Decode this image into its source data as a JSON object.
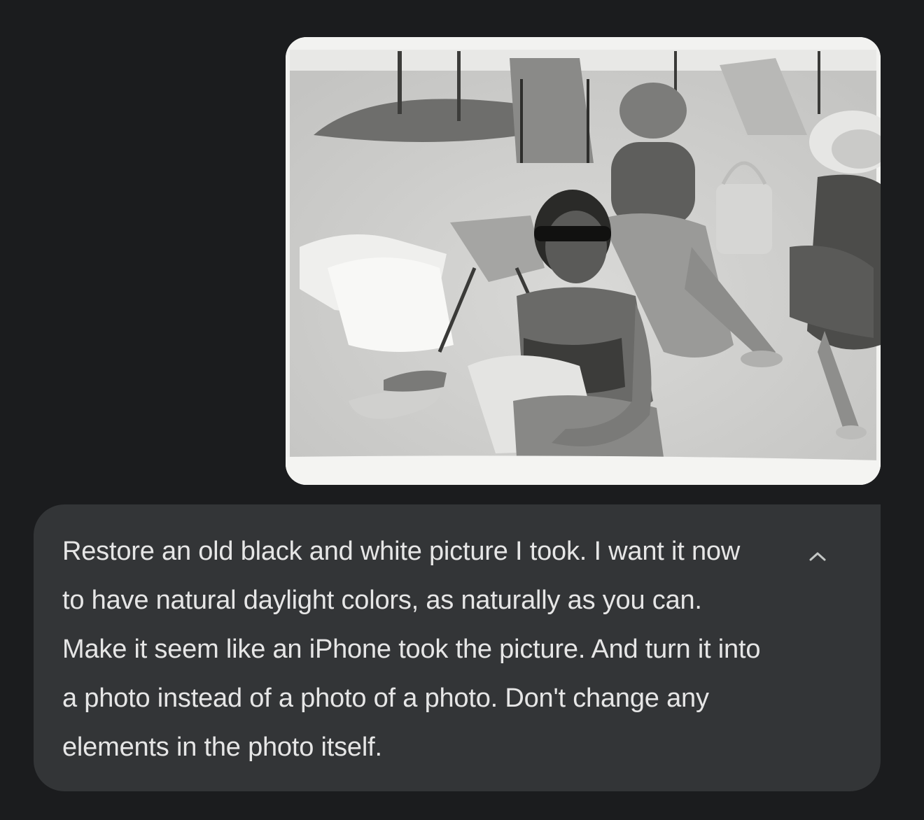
{
  "colors": {
    "background": "#1b1c1e",
    "bubble": "#333537",
    "text": "#e6e6e6",
    "icon": "#c4c7c5"
  },
  "attachment": {
    "type": "photo",
    "tone": "black-and-white"
  },
  "message": {
    "text": "Restore an old black and white picture I took. I want it now to have natural daylight colors, as naturally as you can. Make it seem like an iPhone took the picture. And turn it into a photo instead of a photo of a photo. Don't change any elements in the photo itself."
  },
  "collapse_button": {
    "icon": "chevron-up-icon"
  }
}
